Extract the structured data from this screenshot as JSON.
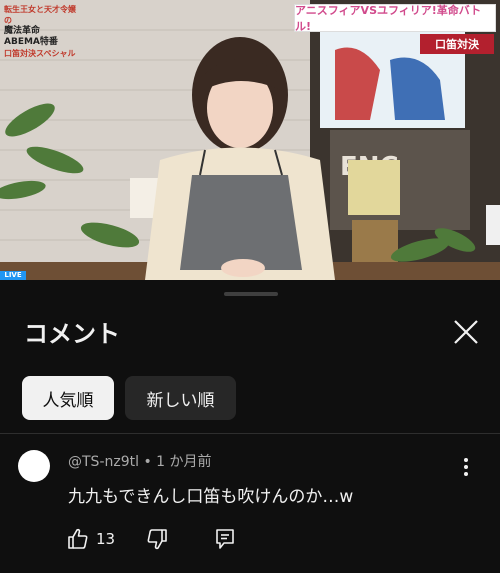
{
  "video": {
    "caption_left": [
      "転生王女と天才令嬢の",
      "魔法革命",
      "ABEMA特番",
      "口笛対決スペシャル"
    ],
    "banner": "アニスフィアVSユフィリア!革命バトル!",
    "badge": "口笛対決",
    "live_label": "LIVE"
  },
  "sheet": {
    "title": "コメント",
    "close_icon": "close-icon",
    "filters": [
      {
        "label": "人気順",
        "selected": true
      },
      {
        "label": "新しい順",
        "selected": false
      }
    ]
  },
  "comment": {
    "author": "@TS-nz9tl",
    "separator": " • ",
    "time": "1 か月前",
    "text": "九九もできんし口笛も吹けんのか…w",
    "likes": "13",
    "icons": {
      "like": "thumbs-up-icon",
      "dislike": "thumbs-down-icon",
      "reply": "reply-icon",
      "more": "more-vertical-icon"
    }
  },
  "colors": {
    "background": "#0f0f0f",
    "text": "#f1f1f1",
    "secondary_text": "#aaaaaa",
    "chip_selected": "#f1f1f1",
    "chip_unselected": "#272727"
  }
}
